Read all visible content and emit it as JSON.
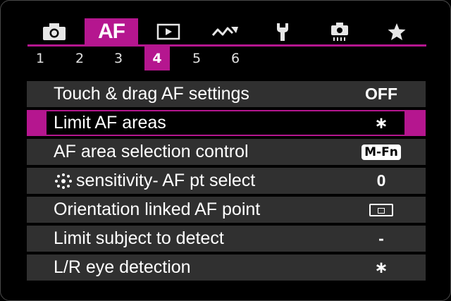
{
  "colors": {
    "accent": "#b5168f",
    "row_bg": "#303030",
    "background": "#000000"
  },
  "tabs": [
    {
      "icon": "camera-icon",
      "label": "",
      "active": false
    },
    {
      "icon": "",
      "label": "AF",
      "active": true
    },
    {
      "icon": "playback-icon",
      "label": "",
      "active": false
    },
    {
      "icon": "wireless-icon",
      "label": "",
      "active": false
    },
    {
      "icon": "wrench-icon",
      "label": "",
      "active": false
    },
    {
      "icon": "custom-camera-icon",
      "label": "",
      "active": false
    },
    {
      "icon": "star-icon",
      "label": "",
      "active": false
    }
  ],
  "pages": [
    "1",
    "2",
    "3",
    "4",
    "5",
    "6"
  ],
  "active_page": "4",
  "menu": {
    "items": [
      {
        "label": "Touch & drag AF settings",
        "value": "OFF",
        "value_kind": "text"
      },
      {
        "label": "Limit AF areas",
        "value": "∗",
        "value_kind": "asterisk",
        "selected": true
      },
      {
        "label": "AF area selection control",
        "value": "M-Fn",
        "value_kind": "badge"
      },
      {
        "label": "sensitivity- AF pt select",
        "value": "0",
        "value_kind": "text",
        "label_icon": "dial-icon"
      },
      {
        "label": "Orientation linked AF point",
        "value": "",
        "value_kind": "icon",
        "value_icon": "orientation-frame-icon"
      },
      {
        "label": "Limit subject to detect",
        "value": "-",
        "value_kind": "text"
      },
      {
        "label": "L/R eye detection",
        "value": "∗",
        "value_kind": "asterisk"
      }
    ]
  }
}
